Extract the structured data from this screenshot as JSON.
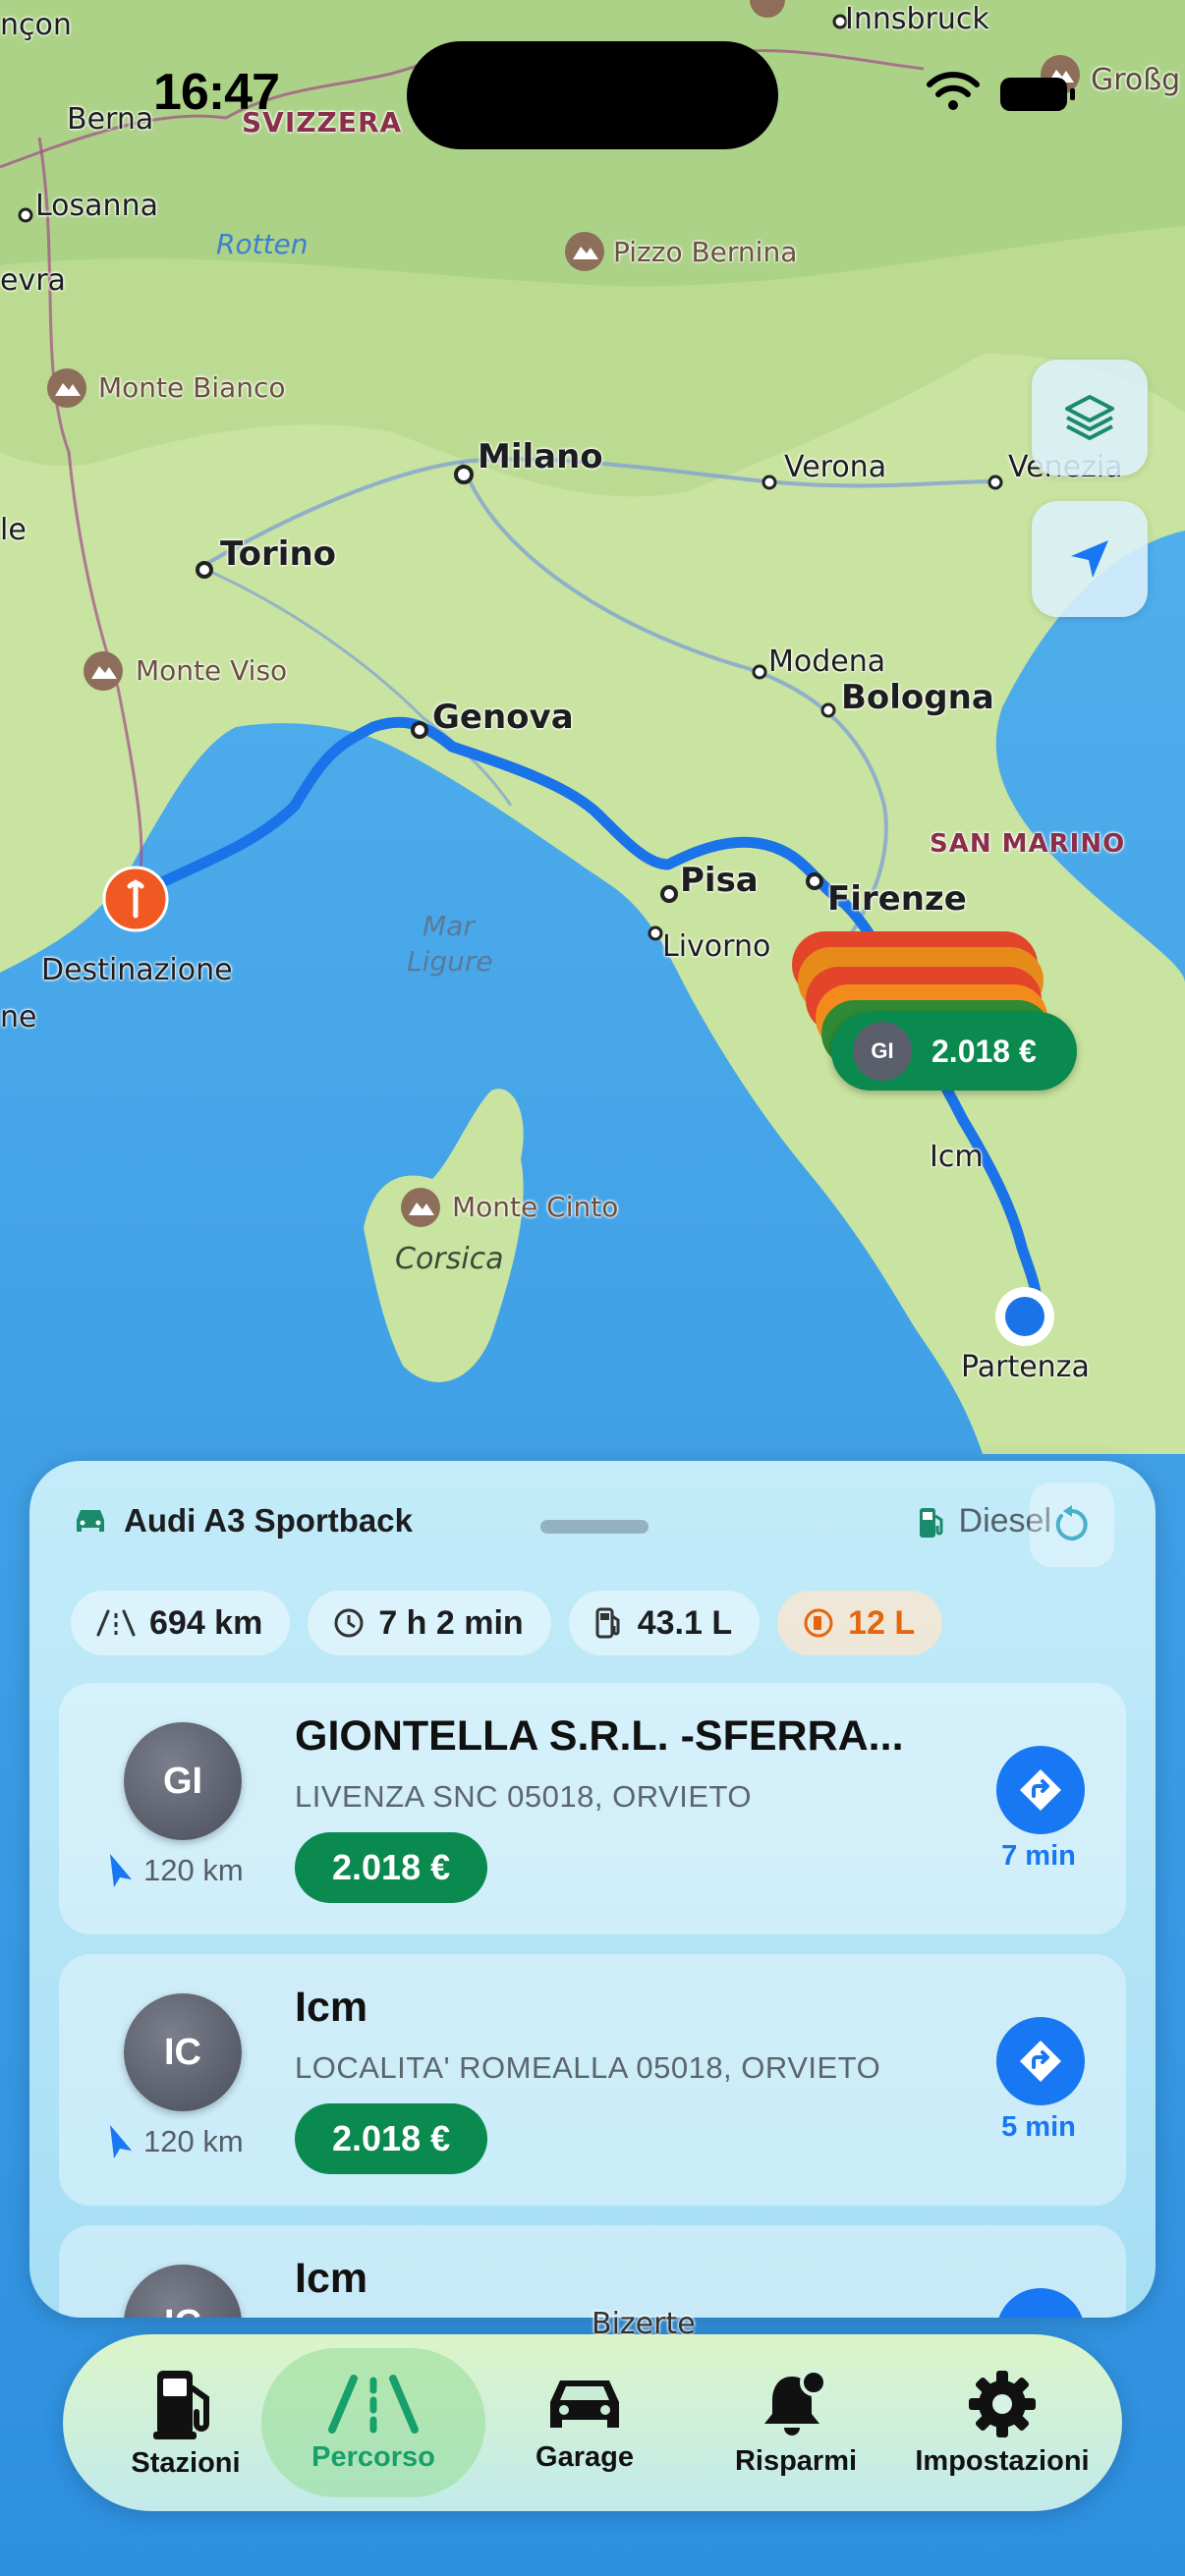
{
  "status_bar": {
    "time": "16:47"
  },
  "map": {
    "cities": [
      "Milano",
      "Torino",
      "Genova",
      "Verona",
      "Modena",
      "Bologna",
      "Pisa",
      "Livorno",
      "Firenze",
      "Innsbruck",
      "Berna",
      "Losanna",
      "Venezia"
    ],
    "peaks": [
      "Monte Bianco",
      "Monte Viso",
      "Pizzo Bernina",
      "Monte Cinto"
    ],
    "regions": [
      "SVIZZERA",
      "SAN MARINO"
    ],
    "seas": [
      "Mar",
      "Ligure",
      "Corsica",
      "Rotten"
    ],
    "edge_labels": [
      "nçon",
      "evra",
      "le",
      "ne",
      "Großg",
      "Bizerte",
      "Icm"
    ],
    "destination_label": "Destinazione",
    "start_label": "Partenza",
    "top_marker_price": "2.018 €",
    "top_marker_initials": "GI"
  },
  "colors": {
    "route": "#1a73e8",
    "price_green": "#0a8a4e",
    "destination": "#f05a22",
    "accent_blue": "#1877f2",
    "fuel_orange": "#e5650f",
    "tab_active": "#18a06a"
  },
  "sheet": {
    "vehicle": "Audi A3 Sportback",
    "fuel_type": "Diesel",
    "stats": {
      "distance": "694 km",
      "duration": "7 h 2 min",
      "consumption": "43.1 L",
      "tank": "12 L"
    },
    "stations": [
      {
        "initials": "GI",
        "name": "GIONTELLA S.R.L. -SFERRA...",
        "address": "LIVENZA SNC 05018, ORVIETO",
        "price": "2.018 €",
        "distance": "120 km",
        "eta": "7 min"
      },
      {
        "initials": "IC",
        "name": "Icm",
        "address": "LOCALITA' ROMEALLA  05018, ORVIETO",
        "price": "2.018 €",
        "distance": "120 km",
        "eta": "5 min"
      },
      {
        "initials": "IC",
        "name": "Icm"
      }
    ]
  },
  "tabbar": {
    "items": [
      {
        "label": "Stazioni",
        "icon": "fuel-pump-icon"
      },
      {
        "label": "Percorso",
        "icon": "road-icon",
        "active": true
      },
      {
        "label": "Garage",
        "icon": "car-icon"
      },
      {
        "label": "Risparmi",
        "icon": "bell-badge-icon"
      },
      {
        "label": "Impostazioni",
        "icon": "gear-icon"
      }
    ]
  }
}
